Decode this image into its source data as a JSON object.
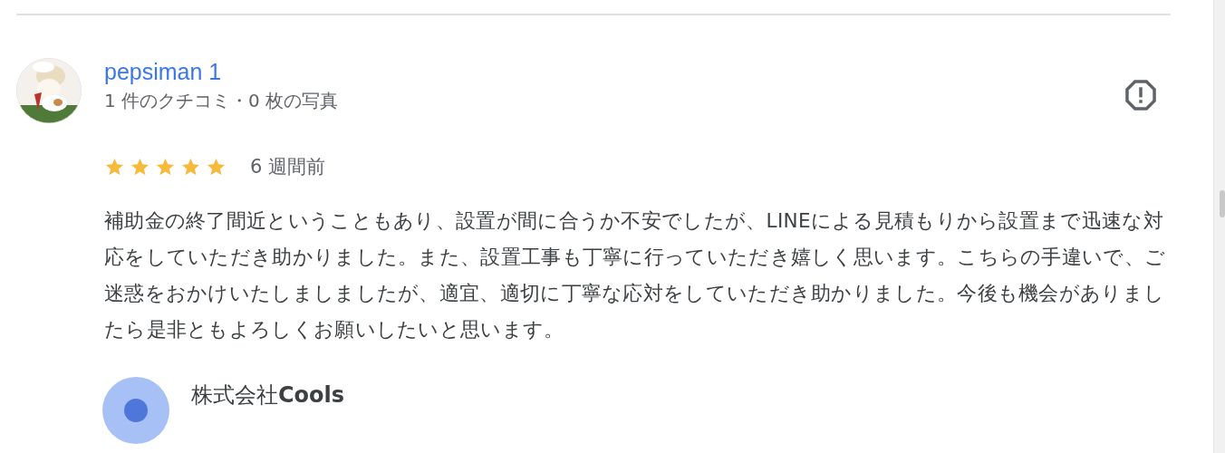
{
  "review": {
    "author": "pepsiman 1",
    "author_stats": "1 件のクチコミ・0 枚の写真",
    "stars": 5,
    "time": "6 週間前",
    "text": "補助金の終了間近ということもあり、設置が間に合うか不安でしたが、LINEによる見積もりから設置まで迅速な対応をしていただき助かりました。また、設置工事も丁寧に行っていただき嬉しく思います。こちらの手違いで、ご迷惑をおかけいたしましましたが、適宜、適切に丁寧な応対をしていただき助かりました。今後も機会がありましたら是非ともよろしくお願いしたいと思います。",
    "owner_response": {
      "author": "株式会社**Cools**"
    }
  }
}
